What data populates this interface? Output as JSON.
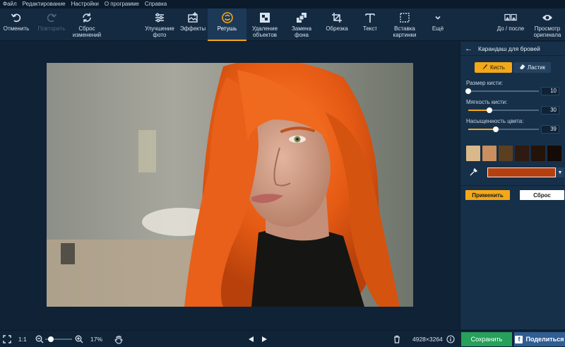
{
  "menu": [
    "Файл",
    "Редактирование",
    "Настройки",
    "О программе",
    "Справка"
  ],
  "toolbar": {
    "undo": "Отменить",
    "redo": "Повторить",
    "reset_changes": "Сброс\nизменений",
    "enhance": "Улучшение\nфото",
    "effects": "Эффекты",
    "retouch": "Ретушь",
    "remove_objects": "Удаление\nобъектов",
    "replace_bg": "Замена\nфона",
    "crop": "Обрезка",
    "text": "Текст",
    "insert_picture": "Вставка\nкартинки",
    "more": "Ещё",
    "before_after": "До / после",
    "view_original": "Просмотр\nоригинала"
  },
  "panel": {
    "title": "Карандаш для бровей",
    "brush_label": "Кисть",
    "eraser_label": "Ластик",
    "sliders": [
      {
        "label": "Размер кисти:",
        "value": "10",
        "percent": 0
      },
      {
        "label": "Мягкость кисти:",
        "value": "30",
        "percent": 30
      },
      {
        "label": "Насыщенность цвета:",
        "value": "39",
        "percent": 39
      }
    ],
    "swatches": [
      "#d9b98a",
      "#c98f5e",
      "#5b3f20",
      "#2e1a10",
      "#231309",
      "#140b06"
    ],
    "current_color": "#b5400f",
    "apply_label": "Применить",
    "reset_label": "Сброс"
  },
  "status": {
    "zoom_fit_label": "1:1",
    "zoom_percent": "17%",
    "zoom_level": 0.17,
    "image_size": "4928×3264",
    "save_label": "Сохранить",
    "share_label": "Поделиться"
  },
  "colors": {
    "accent": "#f4a818",
    "save_green": "#26a05a",
    "share_blue": "#2f5d94"
  }
}
